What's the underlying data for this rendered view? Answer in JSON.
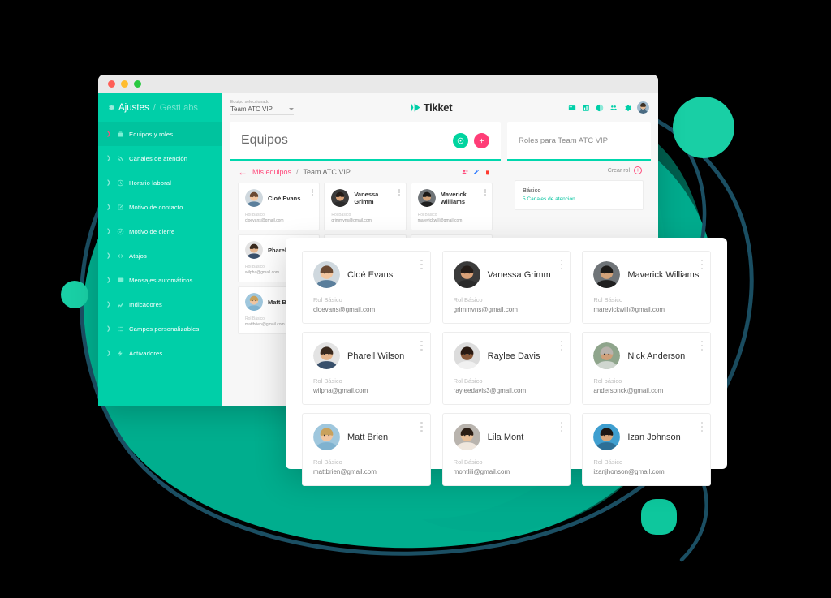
{
  "window": {
    "traffic_lights": [
      "close",
      "minimize",
      "maximize"
    ]
  },
  "sidebar": {
    "header": {
      "title": "Ajustes",
      "separator": "/",
      "subtitle": "GestLabs",
      "icon": "gear-icon"
    },
    "items": [
      {
        "label": "Equipos y roles",
        "icon": "team-icon",
        "active": true
      },
      {
        "label": "Canales de atención",
        "icon": "broadcast-icon",
        "active": false
      },
      {
        "label": "Horario laboral",
        "icon": "clock-icon",
        "active": false
      },
      {
        "label": "Motivo de contacto",
        "icon": "edit-note-icon",
        "active": false
      },
      {
        "label": "Motivo de cierre",
        "icon": "check-circle-icon",
        "active": false
      },
      {
        "label": "Atajos",
        "icon": "code-icon",
        "active": false
      },
      {
        "label": "Mensajes automáticos",
        "icon": "chat-bubble-icon",
        "active": false
      },
      {
        "label": "Indicadores",
        "icon": "line-chart-icon",
        "active": false
      },
      {
        "label": "Campos personalizables",
        "icon": "list-icon",
        "active": false
      },
      {
        "label": "Activadores",
        "icon": "bolt-icon",
        "active": false
      }
    ]
  },
  "topbar": {
    "team_select": {
      "label": "Equipo seleccionado",
      "value": "Team ATC VIP",
      "icon": "chevron-down-icon"
    },
    "brand": {
      "name": "Tikket",
      "icon": "tikket-logo-icon"
    },
    "icons": [
      "ticket-icon",
      "bar-chart-icon",
      "pie-chart-icon",
      "users-icon",
      "gear-icon"
    ],
    "avatar": "user-avatar"
  },
  "teams_panel": {
    "title": "Equipos",
    "actions": [
      {
        "name": "info-button",
        "icon": "info-icon",
        "color": "#00d49f"
      },
      {
        "name": "add-team-button",
        "icon": "plus-icon",
        "color": "#ff3d77"
      }
    ],
    "breadcrumb": {
      "back_icon": "arrow-left-icon",
      "link": "Mis equipos",
      "separator": "/",
      "current": "Team ATC VIP"
    },
    "row_actions": [
      {
        "name": "add-member-icon",
        "icon": "user-plus-icon",
        "color": "#ff4d7e"
      },
      {
        "name": "edit-team-icon",
        "icon": "pencil-icon",
        "color": "#2f7bff"
      },
      {
        "name": "delete-team-icon",
        "icon": "trash-icon",
        "color": "#ff3b30"
      }
    ],
    "members": [
      {
        "name": "Cloé Evans",
        "role": "Rol Básico",
        "email": "cloevans@gmail.com"
      },
      {
        "name": "Vanessa Grimm",
        "role": "Rol Básico",
        "email": "grimmvns@gmail.com"
      },
      {
        "name": "Maverick Williams",
        "role": "Rol Básico",
        "email": "marevickwill@gmail.com"
      },
      {
        "name": "Pharell Wilson",
        "role": "Rol Básico",
        "email": "wilpha@gmail.com"
      },
      {
        "name": "Raylee Davis",
        "role": "Rol Básico",
        "email": "rayleedavis3@gmail.com"
      },
      {
        "name": "Nick Anderson",
        "role": "Rol básico",
        "email": "andersonck@gmail.com"
      },
      {
        "name": "Matt Brien",
        "role": "Rol Básico",
        "email": "mattbrien@gmail.com"
      },
      {
        "name": "Lila Mont",
        "role": "Rol Básico",
        "email": "montlili@gmail.com"
      },
      {
        "name": "Izan Johnson",
        "role": "Rol Básico",
        "email": "izanjhonson@gmail.com"
      }
    ]
  },
  "roles_panel": {
    "title": "Roles para Team ATC VIP",
    "create_label": "Crear rol",
    "create_icon": "plus-circle-icon",
    "roles": [
      {
        "name": "Básico",
        "detail": "5 Canales de atención"
      }
    ]
  },
  "overlay": {
    "members": [
      {
        "name": "Cloé Evans",
        "role": "Rol Básico",
        "email": "cloevans@gmail.com"
      },
      {
        "name": "Vanessa Grimm",
        "role": "Rol Básico",
        "email": "grimmvns@gmail.com"
      },
      {
        "name": "Maverick Williams",
        "role": "Rol Básico",
        "email": "marevickwill@gmail.com"
      },
      {
        "name": "Pharell Wilson",
        "role": "Rol Básico",
        "email": "wilpha@gmail.com"
      },
      {
        "name": "Raylee Davis",
        "role": "Rol Básico",
        "email": "rayleedavis3@gmail.com"
      },
      {
        "name": "Nick Anderson",
        "role": "Rol básico",
        "email": "andersonck@gmail.com"
      },
      {
        "name": "Matt Brien",
        "role": "Rol Básico",
        "email": "mattbrien@gmail.com"
      },
      {
        "name": "Lila Mont",
        "role": "Rol Básico",
        "email": "montlili@gmail.com"
      },
      {
        "name": "Izan Johnson",
        "role": "Rol Básico",
        "email": "izanjhonson@gmail.com"
      }
    ]
  },
  "colors": {
    "brand_teal": "#00cfa8",
    "accent_pink": "#ff3d77",
    "accent_teal": "#00d49f",
    "outline_navy": "#1b4f63",
    "blob_teal": "#00bd9a"
  }
}
